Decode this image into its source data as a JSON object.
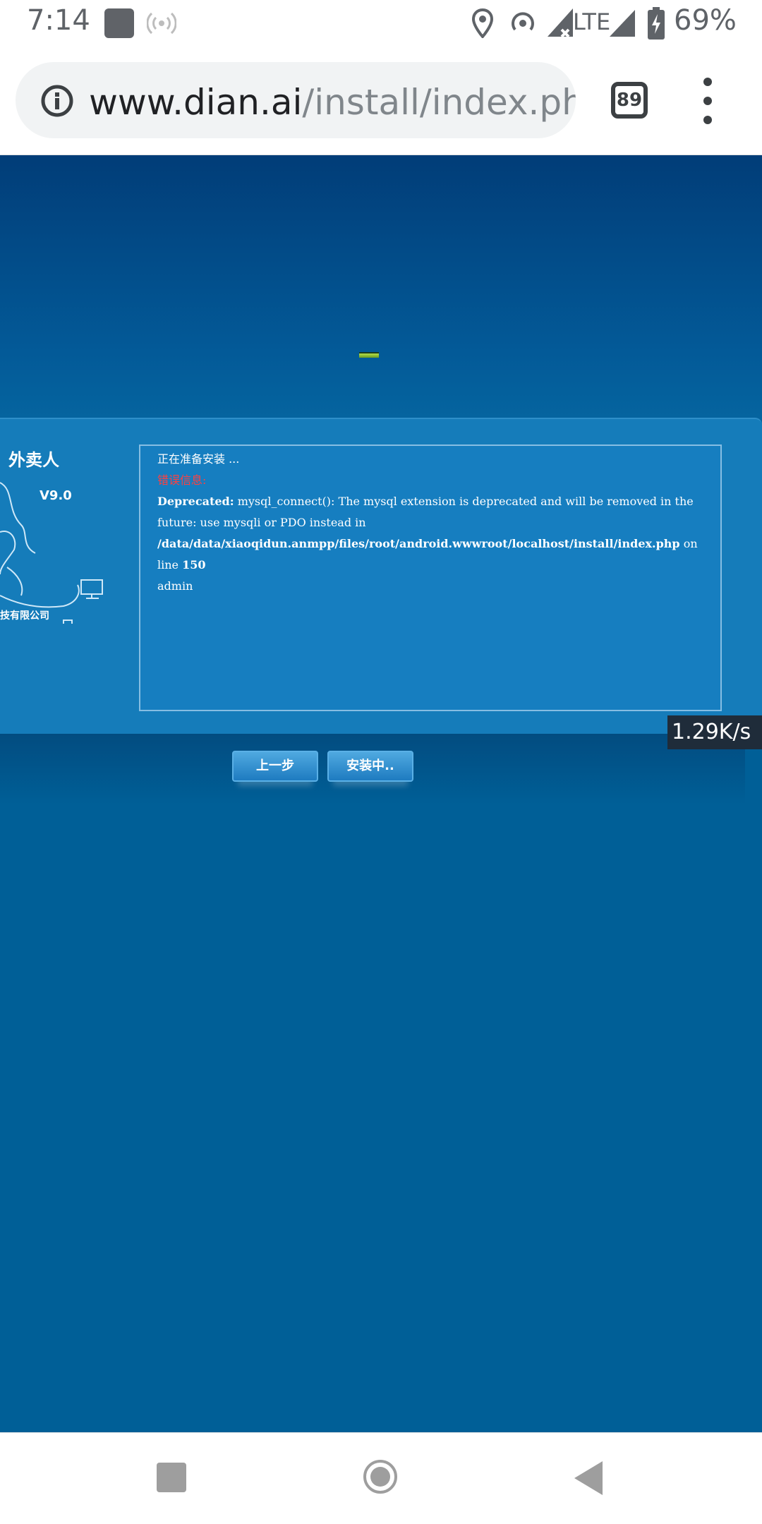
{
  "status_bar": {
    "time": "7:14",
    "network": "LTE",
    "battery": "69%",
    "icons": [
      "app-square-icon",
      "hotspot-icon",
      "location-icon",
      "wifi-icon",
      "signal-icon",
      "battery-icon"
    ]
  },
  "browser": {
    "url_host": "www.dian.ai",
    "url_path": "/install/index.php",
    "tab_count": "89",
    "icons": [
      "info-icon",
      "tabs-icon",
      "overflow-menu-icon"
    ]
  },
  "installer": {
    "brand_title": "外卖人",
    "version": "V9.0",
    "company": "技有限公司",
    "log": {
      "preparing": "正在准备安装 ...",
      "error_label": "错误信息:",
      "deprecated_label": "Deprecated:",
      "deprecated_msg": " mysql_connect(): The mysql extension is deprecated and will be removed in the future: use mysqli or PDO instead in",
      "file_path": "/data/data/xiaoqidun.anmpp/files/root/android.wwwroot/localhost/install/index.php",
      "on_line_text": " on line ",
      "line_number": "150",
      "admin": "admin"
    },
    "buttons": {
      "prev": "上一步",
      "install": "安装中.."
    }
  },
  "speed_overlay": "1.29K/s",
  "colors": {
    "page_bg": "#005f97",
    "panel_bg": "#157cba",
    "error_red": "#ff4040"
  }
}
